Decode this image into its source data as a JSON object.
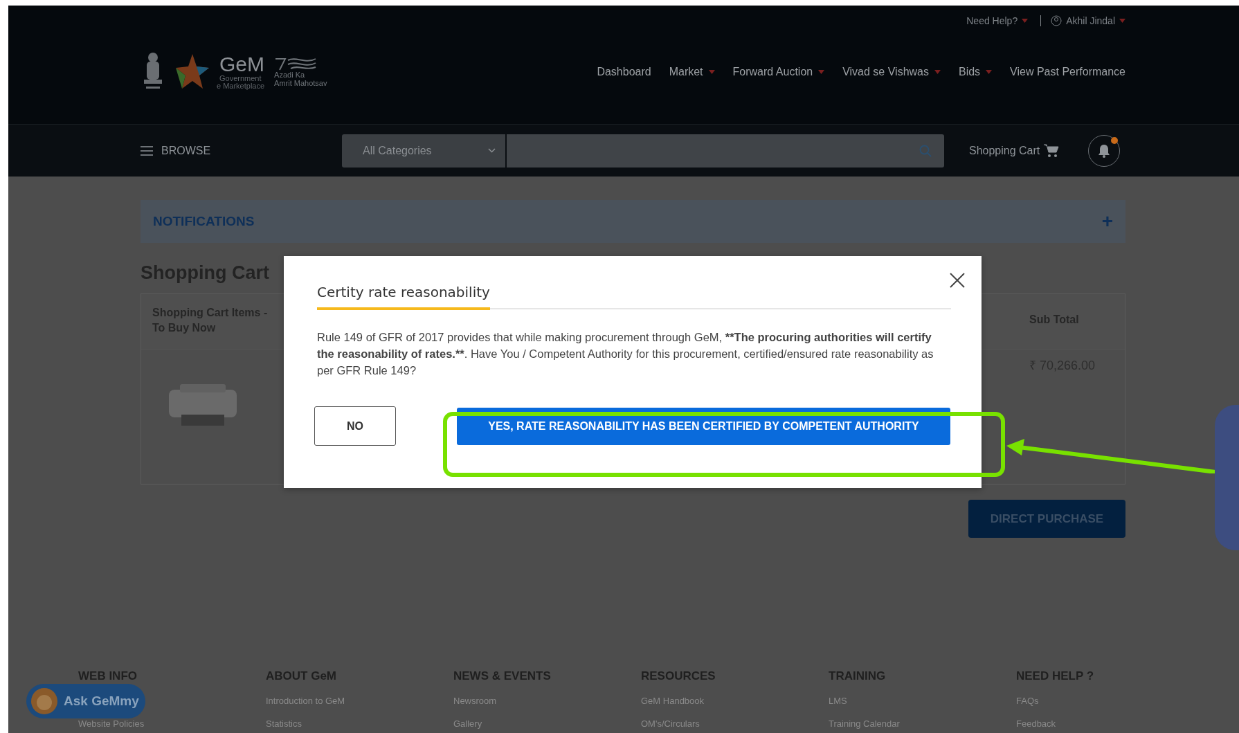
{
  "header": {
    "top_links": [
      {
        "label": "Need Help?",
        "kind": "menu"
      },
      {
        "label": "Akhil Jindal",
        "kind": "user"
      }
    ],
    "logo": {
      "name": "GeM",
      "line_1": "Government",
      "line_2": "e Marketplace"
    },
    "campaign_logo": {
      "words": [
        "Azadi",
        "Ka",
        "Amrit",
        "Mahotsav"
      ]
    },
    "nav": [
      {
        "label": "Dashboard",
        "dropdown": false
      },
      {
        "label": "Market",
        "dropdown": true
      },
      {
        "label": "Forward Auction",
        "dropdown": true
      },
      {
        "label": "Vivad se Vishwas",
        "dropdown": true
      },
      {
        "label": "Bids",
        "dropdown": true
      },
      {
        "label": "View Past Performance",
        "dropdown": false
      }
    ]
  },
  "toolbar": {
    "browse": "BROWSE",
    "category": "All Categories",
    "cart": "Shopping Cart",
    "unread_alerts": true
  },
  "notifications": {
    "title": "NOTIFICATIONS",
    "toggle": "+"
  },
  "cart": {
    "title": "Shopping Cart",
    "columns": [
      "Shopping Cart Items - To Buy Now",
      "Sub Total"
    ],
    "rows": [
      {
        "subtotal": "₹ 70,266.00"
      }
    ],
    "action": "DIRECT PURCHASE"
  },
  "modal": {
    "title": "Certity rate reasonability",
    "body": [
      {
        "text": "Rule 149 of GFR of 2017 provides that while making procurement through GeM, ",
        "bold": false
      },
      {
        "text": "**The procuring authorities will certify the reasonability of rates.**",
        "bold": true
      },
      {
        "text": ". Have You / Competent Authority for this procurement, certified/ensured rate reasonability as per GFR Rule 149?",
        "bold": false
      }
    ],
    "buttons": [
      {
        "label": "NO",
        "kind": "secondary",
        "highlighted": false
      },
      {
        "label": "YES, RATE REASONABILITY HAS BEEN CERTIFIED BY COMPETENT AUTHORITY",
        "kind": "primary",
        "highlighted": true
      }
    ]
  },
  "footer": [
    {
      "title": "WEB INFO",
      "links": [
        "Website Policies"
      ]
    },
    {
      "title": "ABOUT GeM",
      "links": [
        "Introduction to GeM",
        "Statistics"
      ]
    },
    {
      "title": "NEWS & EVENTS",
      "links": [
        "Newsroom",
        "Gallery"
      ]
    },
    {
      "title": "RESOURCES",
      "links": [
        "GeM Handbook",
        "OM's/Circulars"
      ]
    },
    {
      "title": "TRAINING",
      "links": [
        "LMS",
        "Training Calendar"
      ]
    },
    {
      "title": "NEED HELP ?",
      "links": [
        "FAQs",
        "Feedback"
      ]
    }
  ],
  "chat": {
    "label": "Ask GeMmy"
  }
}
